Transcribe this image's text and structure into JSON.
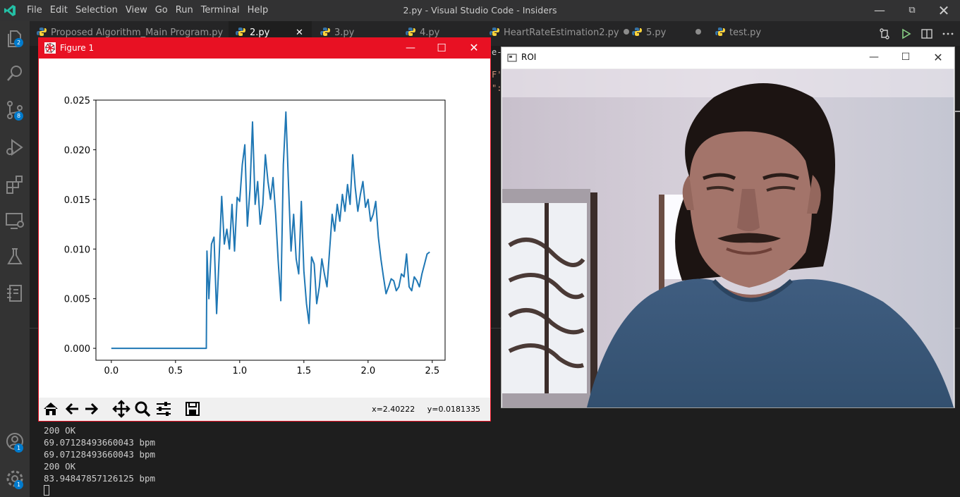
{
  "window": {
    "title": "2.py - Visual Studio Code - Insiders",
    "menu": [
      "File",
      "Edit",
      "Selection",
      "View",
      "Go",
      "Run",
      "Terminal",
      "Help"
    ]
  },
  "activity_bar": {
    "explorer_badge": "2",
    "scm_badge": "8",
    "accounts_badge": "1",
    "settings_badge": "1"
  },
  "tabs": [
    {
      "label": "Proposed Algorithm_Main Program.py"
    },
    {
      "label": "2.py"
    },
    {
      "label": "3.py"
    },
    {
      "label": "4.py"
    },
    {
      "label": "HeartRateEstimation2.py"
    },
    {
      "label": "5.py"
    },
    {
      "label": "test.py"
    }
  ],
  "editor_fragments": [
    "e-",
    "F'",
    "\":"
  ],
  "terminal": {
    "lines": [
      "200 OK",
      "69.07128493660043 bpm",
      "69.07128493660043 bpm",
      "200 OK",
      "83.94847857126125 bpm"
    ]
  },
  "figure": {
    "title": "Figure 1",
    "coords": "x=2.40222     y=0.0181335"
  },
  "roi": {
    "title": "ROI"
  },
  "chart_data": {
    "type": "line",
    "xlim": [
      -0.12,
      2.6
    ],
    "ylim": [
      -0.0012,
      0.025
    ],
    "xticks": [
      "0.0",
      "0.5",
      "1.0",
      "1.5",
      "2.0",
      "2.5"
    ],
    "yticks": [
      "0.000",
      "0.005",
      "0.010",
      "0.015",
      "0.020",
      "0.025"
    ],
    "x": [
      0.0,
      0.74,
      0.745,
      0.76,
      0.78,
      0.8,
      0.82,
      0.84,
      0.86,
      0.88,
      0.9,
      0.92,
      0.94,
      0.96,
      0.98,
      1.0,
      1.02,
      1.04,
      1.06,
      1.08,
      1.1,
      1.12,
      1.14,
      1.16,
      1.18,
      1.2,
      1.22,
      1.24,
      1.26,
      1.28,
      1.3,
      1.32,
      1.34,
      1.36,
      1.38,
      1.4,
      1.42,
      1.44,
      1.46,
      1.48,
      1.5,
      1.52,
      1.54,
      1.56,
      1.58,
      1.6,
      1.62,
      1.64,
      1.66,
      1.68,
      1.7,
      1.72,
      1.74,
      1.76,
      1.78,
      1.8,
      1.82,
      1.84,
      1.86,
      1.88,
      1.9,
      1.92,
      1.94,
      1.96,
      1.98,
      2.0,
      2.02,
      2.04,
      2.06,
      2.08,
      2.1,
      2.12,
      2.14,
      2.16,
      2.18,
      2.2,
      2.22,
      2.24,
      2.26,
      2.28,
      2.3,
      2.32,
      2.34,
      2.36,
      2.38,
      2.4,
      2.42,
      2.44,
      2.46,
      2.48
    ],
    "y": [
      0.0,
      0.0,
      0.0098,
      0.005,
      0.0105,
      0.0112,
      0.0035,
      0.0092,
      0.0153,
      0.0105,
      0.012,
      0.01,
      0.0145,
      0.0098,
      0.0152,
      0.0148,
      0.0185,
      0.0205,
      0.0123,
      0.016,
      0.0228,
      0.0145,
      0.0168,
      0.0125,
      0.0145,
      0.0195,
      0.0168,
      0.015,
      0.0172,
      0.0135,
      0.0088,
      0.0048,
      0.0185,
      0.0238,
      0.0165,
      0.0098,
      0.0135,
      0.009,
      0.0075,
      0.0148,
      0.0078,
      0.0045,
      0.0025,
      0.0092,
      0.0085,
      0.0045,
      0.0062,
      0.009,
      0.0075,
      0.0062,
      0.0098,
      0.0135,
      0.0118,
      0.0145,
      0.0128,
      0.0155,
      0.0138,
      0.0165,
      0.0145,
      0.0195,
      0.0162,
      0.0138,
      0.0155,
      0.0168,
      0.0142,
      0.015,
      0.0128,
      0.0135,
      0.0148,
      0.0112,
      0.009,
      0.0072,
      0.0055,
      0.0062,
      0.007,
      0.0068,
      0.0058,
      0.0062,
      0.0075,
      0.0072,
      0.0095,
      0.0062,
      0.0058,
      0.0072,
      0.0068,
      0.0062,
      0.0075,
      0.0085,
      0.0095,
      0.0097
    ]
  },
  "colors": {
    "line": "#1f77b4",
    "figure_border": "#e81123",
    "vscode_blue": "#007acc"
  }
}
